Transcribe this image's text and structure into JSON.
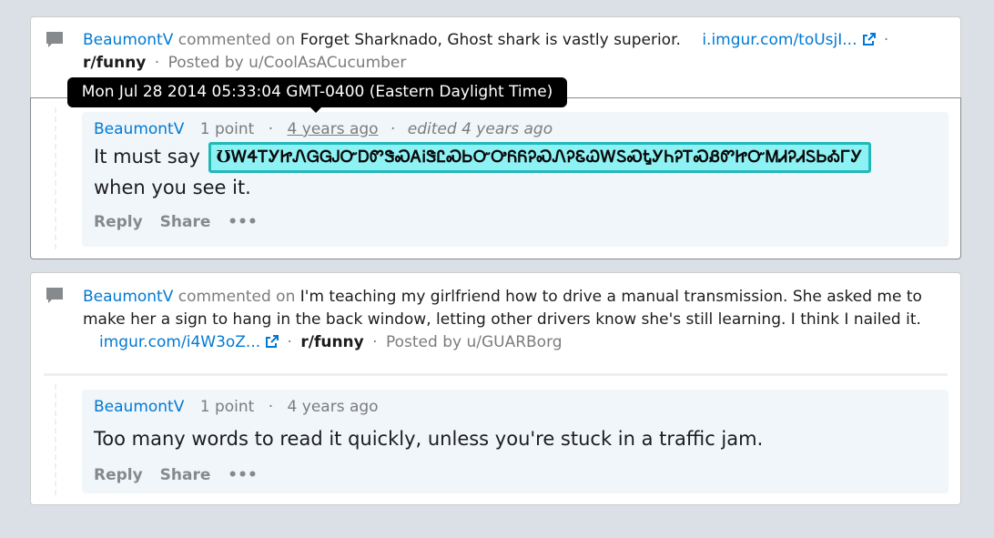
{
  "tooltip": {
    "text": "Mon Jul 28 2014 05:33:04 GMT-0400 (Eastern Daylight Time)"
  },
  "posts": [
    {
      "icon": "comment-icon",
      "user": "BeaumontV",
      "commented_on": "commented on",
      "title": "Forget Sharknado, Ghost shark is vastly superior.",
      "link": "i.imgur.com/toUsjI...",
      "subreddit": "r/funny",
      "posted_by": "Posted by u/CoolAsACucumber",
      "comment": {
        "author": "BeaumontV",
        "points": "1 point",
        "time": "4 years ago",
        "edited": "edited 4 years ago",
        "text_before": "It must say",
        "glyphs": "ƱᎳᏎᎢᎩᏥᏁᏀᏀᎫᏅᎠᏛᏕᏍᎪᎥᏕᏝᏍᏏᏅᎤᏲᏲᎮᏍᏁᎮᏋᏇᎳᏚᏍᎿᎩᏂᎮᎢᏍᏰᏛᏥᏅᎷᏗᎮᏗᏚᏏᎣᎱᎩ",
        "text_after": "when you see it.",
        "reply": "Reply",
        "share": "Share",
        "more": "•••"
      }
    },
    {
      "icon": "comment-icon",
      "user": "BeaumontV",
      "commented_on": "commented on",
      "title": "I'm teaching my girlfriend how to drive a manual transmission. She asked me to make her a sign to hang in the back window, letting other drivers know she's still learning. I think I nailed it.",
      "link": "imgur.com/i4W3oZ...",
      "subreddit": "r/funny",
      "posted_by": "Posted by u/GUARBorg",
      "comment": {
        "author": "BeaumontV",
        "points": "1 point",
        "time": "4 years ago",
        "text": "Too many words to read it quickly, unless you're stuck in a traffic jam.",
        "reply": "Reply",
        "share": "Share",
        "more": "•••"
      }
    }
  ],
  "colors": {
    "background": "#dae0e6",
    "link": "#0079d3",
    "muted": "#7c7c7c",
    "highlight_fill": "#8ef2f5",
    "highlight_border": "#21b8b8"
  }
}
